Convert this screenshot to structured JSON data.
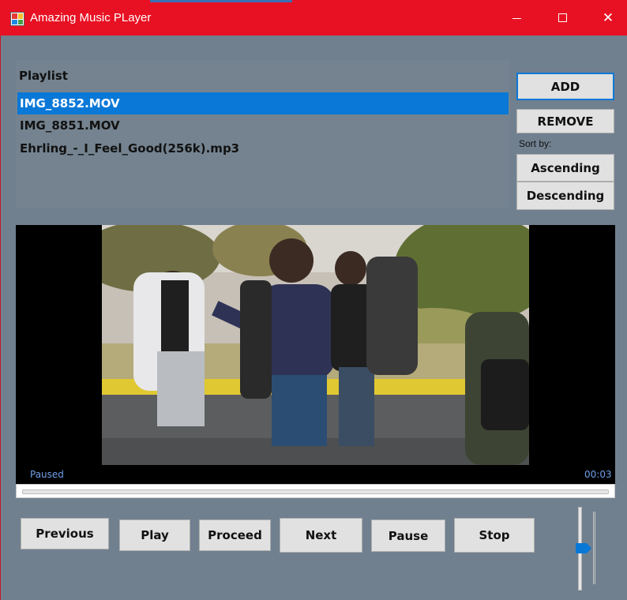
{
  "window": {
    "title": "Amazing Music PLayer",
    "accent_color": "#e81123",
    "icons": {
      "app": "app-grid-icon",
      "minimize": "minimize-icon",
      "maximize": "maximize-icon",
      "close": "close-icon"
    },
    "close_glyph": "✕"
  },
  "playlist": {
    "heading": "Playlist",
    "selection_color": "#0a78d7",
    "items": [
      {
        "label": "IMG_8852.MOV",
        "selected": true
      },
      {
        "label": "IMG_8851.MOV",
        "selected": false
      },
      {
        "label": "Ehrling_-_I_Feel_Good(256k).mp3",
        "selected": false
      }
    ]
  },
  "side_buttons": {
    "add": "ADD",
    "remove": "REMOVE",
    "sort_label": "Sort by:",
    "ascending": "Ascending",
    "descending": "Descending"
  },
  "player": {
    "status": "Paused",
    "time": "00:03",
    "progress": 0.0,
    "volume": 0.55
  },
  "controls": {
    "previous": "Previous",
    "play": "Play",
    "proceed": "Proceed",
    "next": "Next",
    "pause": "Pause",
    "stop": "Stop"
  }
}
